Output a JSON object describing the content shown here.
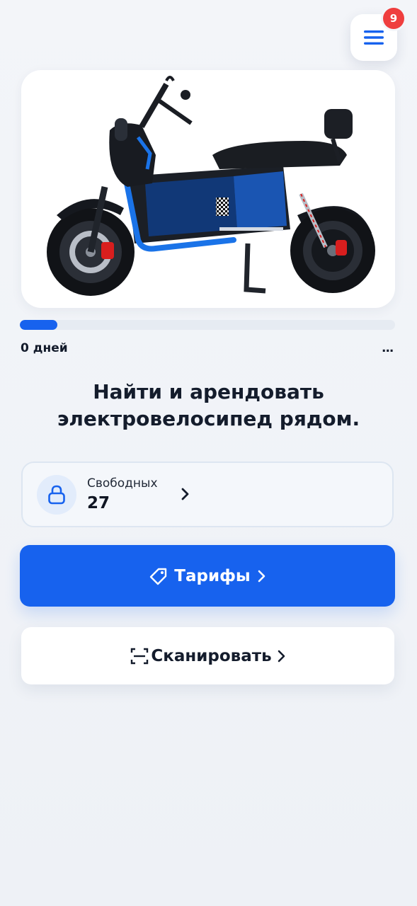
{
  "menu": {
    "badge_count": "9",
    "icon": "hamburger-menu-icon"
  },
  "hero": {
    "image": "electric-scooter-photo",
    "accent_color": "#1a73e8"
  },
  "progress": {
    "fraction": 0.1,
    "days_label": "0 дней",
    "more_label": "..."
  },
  "headline": {
    "line1": "Найти и арендовать",
    "line2": "электровелосипед рядом."
  },
  "availability": {
    "label": "Свободных",
    "count": "27",
    "icon": "lock-icon"
  },
  "buttons": {
    "tariffs_label": "Тарифы",
    "tariffs_icon": "price-tag-icon",
    "scan_label": "Сканировать",
    "scan_icon": "scan-frame-icon"
  },
  "colors": {
    "primary": "#1762ee",
    "badge": "#ef3e3e",
    "text": "#141c2c"
  }
}
